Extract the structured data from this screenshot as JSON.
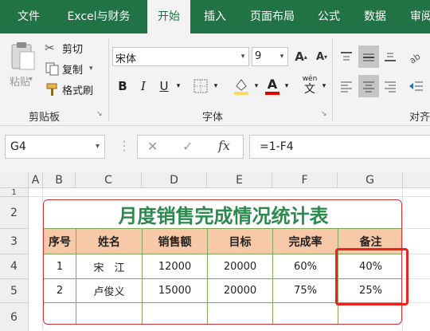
{
  "ribbon_tabs": [
    {
      "label": "文件",
      "active": false
    },
    {
      "label": "Excel与财务",
      "active": false
    },
    {
      "label": "开始",
      "active": true
    },
    {
      "label": "插入",
      "active": false
    },
    {
      "label": "页面布局",
      "active": false
    },
    {
      "label": "公式",
      "active": false
    },
    {
      "label": "数据",
      "active": false
    },
    {
      "label": "审阅",
      "active": false
    }
  ],
  "clipboard": {
    "paste_label": "粘贴",
    "cut_label": "剪切",
    "copy_label": "复制",
    "format_painter_label": "格式刷",
    "group_label": "剪贴板"
  },
  "font": {
    "name_value": "宋体",
    "size_value": "9",
    "group_label": "字体",
    "phonetic_label": "wén"
  },
  "alignment": {
    "group_label": "对齐"
  },
  "formula_bar": {
    "name_box": "G4",
    "fx_label": "fx",
    "formula": "=1-F4"
  },
  "columns": [
    "A",
    "B",
    "C",
    "D",
    "E",
    "F",
    "G"
  ],
  "rows": [
    "1",
    "2",
    "3",
    "4",
    "5",
    "6"
  ],
  "table": {
    "title": "月度销售完成情况统计表",
    "headers": [
      "序号",
      "姓名",
      "销售额",
      "目标",
      "完成率",
      "备注"
    ],
    "rows": [
      [
        "1",
        "宋　江",
        "12000",
        "20000",
        "60%",
        "40%"
      ],
      [
        "2",
        "卢俊义",
        "15000",
        "20000",
        "75%",
        "25%"
      ],
      [
        "",
        "",
        "",
        "",
        "",
        ""
      ]
    ]
  },
  "colors": {
    "ribbon_green": "#217346",
    "title_green": "#2d8a4e",
    "header_fill": "#f8c9a8",
    "highlight_red": "#e8261f"
  }
}
